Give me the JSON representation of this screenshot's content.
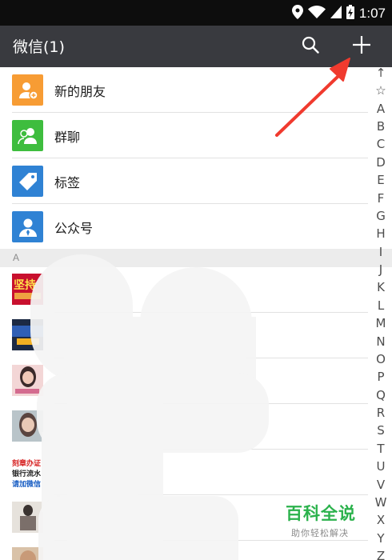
{
  "status_bar": {
    "time": "1:07",
    "icons": [
      "location-icon",
      "wifi-icon",
      "cellular-signal-icon",
      "battery-charging-icon"
    ]
  },
  "app_bar": {
    "title": "微信(1)",
    "actions": [
      "search-icon",
      "plus-icon"
    ]
  },
  "menu_items": [
    {
      "label": "新的朋友",
      "icon": "new-friends-icon",
      "color": "#f79c34"
    },
    {
      "label": "群聊",
      "icon": "group-chat-icon",
      "color": "#3ebd3e"
    },
    {
      "label": "标签",
      "icon": "tag-icon",
      "color": "#2f82d4"
    },
    {
      "label": "公众号",
      "icon": "official-account-icon",
      "color": "#2f82d4"
    }
  ],
  "section_header": "A",
  "contact_thumbnail_texts": {
    "contact_1": "坚持",
    "contact_5_line_1": "刻章办证",
    "contact_5_line_2": "银行流水",
    "contact_5_line_3": "请加微信"
  },
  "index_letters": [
    "↑",
    "☆",
    "A",
    "B",
    "C",
    "D",
    "E",
    "F",
    "G",
    "H",
    "I",
    "J",
    "K",
    "L",
    "M",
    "N",
    "O",
    "P",
    "Q",
    "R",
    "S",
    "T",
    "U",
    "V",
    "W",
    "X",
    "Y",
    "Z"
  ],
  "watermark": {
    "title": "百科全说",
    "subtitle": "助你轻松解决"
  },
  "annotation": {
    "color": "#f03a2e",
    "target": "plus-button"
  },
  "colors": {
    "status_bar": "#0d0d0d",
    "app_bar": "#393a3f",
    "section_header_bg": "#ececec",
    "watermark_green": "#2bb24c"
  }
}
